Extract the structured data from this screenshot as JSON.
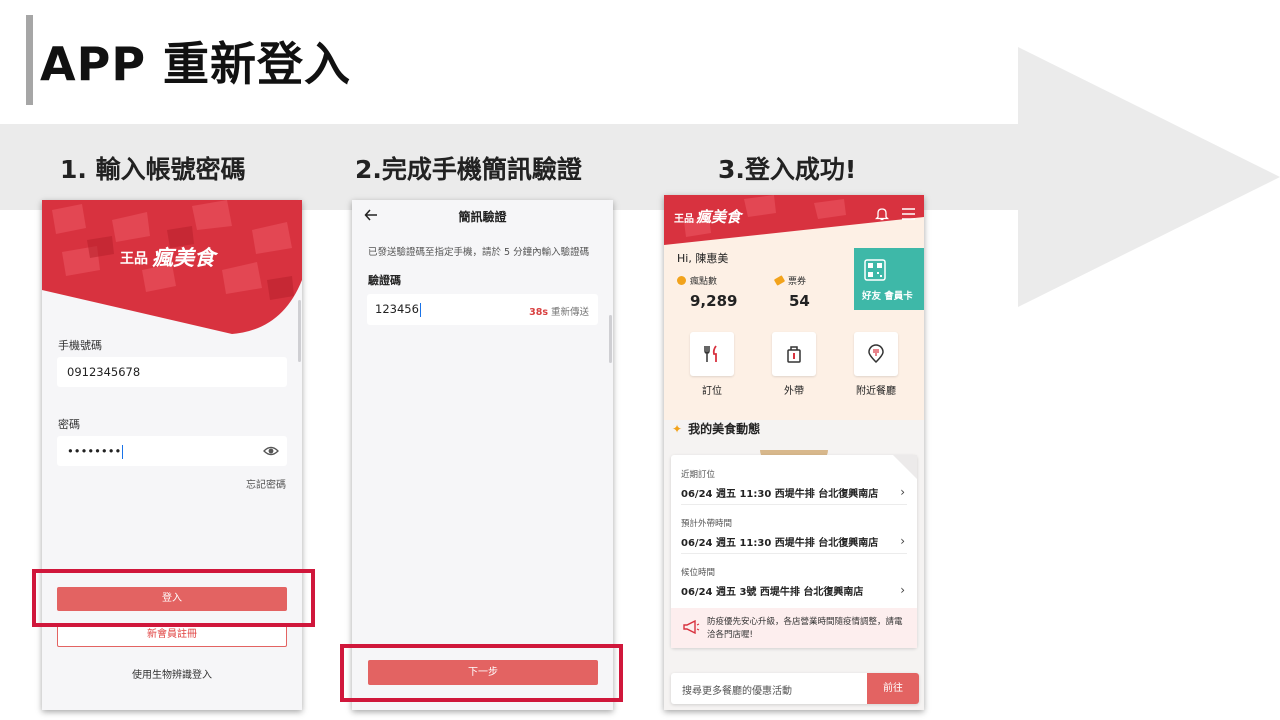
{
  "title": "APP 重新登入",
  "steps": [
    "1. 輸入帳號密碼",
    "2.完成手機簡訊驗證",
    "3.登入成功!"
  ],
  "brand": {
    "small": "王品",
    "big": "瘋美食"
  },
  "colors": {
    "accent_red": "#e36362",
    "highlight": "#d0173b",
    "teal": "#3eb8a8",
    "gold": "#f2a31c"
  },
  "login": {
    "phone_label": "手機號碼",
    "phone_value": "0912345678",
    "password_label": "密碼",
    "password_value": "••••••••",
    "forgot": "忘記密碼",
    "login_button": "登入",
    "register_button": "新會員註冊",
    "biometric": "使用生物辨識登入"
  },
  "sms": {
    "title": "簡訊驗證",
    "hint": "已發送驗證碼至指定手機，請於 5 分鐘內輸入驗證碼",
    "code_label": "驗證碼",
    "code_value": "123456",
    "countdown": "38s",
    "resend": "重新傳送",
    "next_button": "下一步"
  },
  "home": {
    "greeting": "Hi, 陳惠美",
    "points_label": "瘋點數",
    "points_value": "9,289",
    "tickets_label": "票券",
    "tickets_value": "54",
    "member_card": "好友 會員卡",
    "services": [
      "訂位",
      "外帶",
      "附近餐廳"
    ],
    "section_title": "我的美食動態",
    "rows": [
      {
        "label": "近期訂位",
        "value": "06/24 週五 11:30 西堤牛排 台北復興南店"
      },
      {
        "label": "預計外帶時間",
        "value": "06/24 週五 11:30 西堤牛排 台北復興南店"
      },
      {
        "label": "候位時間",
        "value": "06/24 週五 3號 西堤牛排 台北復興南店"
      }
    ],
    "notice": "防疫優先安心升級，各店營業時間隨疫情調整，請電洽各門店喔!",
    "search_placeholder": "搜尋更多餐廳的優惠活動",
    "go_button": "前往"
  }
}
